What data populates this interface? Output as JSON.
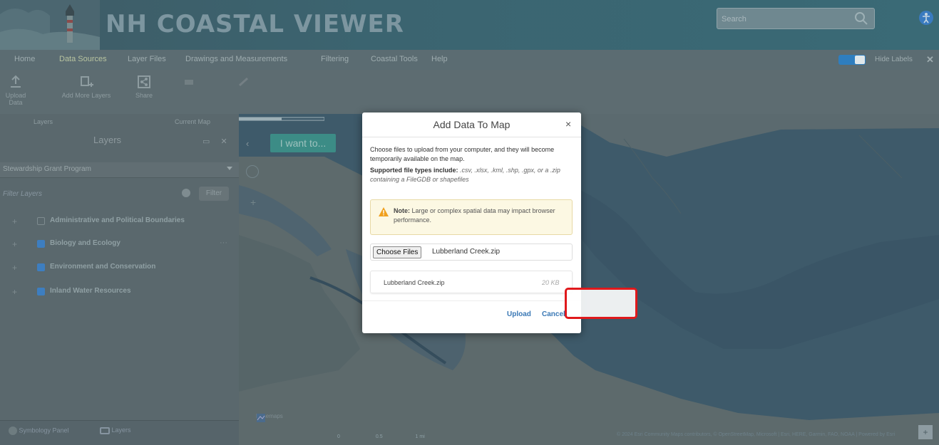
{
  "header": {
    "title": "NH COASTAL VIEWER",
    "search_placeholder": "Search",
    "accent_color": "#3b6470"
  },
  "menubar": {
    "items": [
      "Home",
      "Data Sources",
      "Layer Files",
      "Drawings and Measurements",
      "Filtering",
      "Coastal Tools",
      "Help"
    ],
    "toggle_label": "Hide Labels",
    "close_symbol": "✕"
  },
  "toolbar": {
    "tools": [
      "Upload Data",
      "Add More Layers",
      "Share",
      "",
      ""
    ],
    "group_labels": [
      "Layers",
      "Current Map"
    ]
  },
  "layers_panel": {
    "title": "Layers",
    "selected_layer_list": "Stewardship Grant Program",
    "filter_placeholder": "Filter Layers",
    "filter_button": "Filter",
    "layers": [
      {
        "name": "Administrative and Political Boundaries",
        "checked": false,
        "expand": "+"
      },
      {
        "name": "Biology and Ecology",
        "checked": true,
        "expand": "+"
      },
      {
        "name": "Environment and Conservation",
        "checked": true,
        "expand": "+"
      },
      {
        "name": "Inland Water Resources",
        "checked": true,
        "expand": "+"
      }
    ],
    "bottom_tabs": [
      "Symbology Panel",
      "Layers"
    ]
  },
  "map": {
    "i_want_to_label": "I want to...",
    "basemap_label": "Basemaps",
    "scale_labels": [
      "0",
      "0.5",
      "1 mi"
    ],
    "attribution": "© 2024 Esri Community Maps contributors, © OpenStreetMap, Microsoft | Esri, HERE, Garmin, FAO, NOAA | Powered by Esri",
    "attribution_toggle": "+"
  },
  "modal": {
    "title": "Add Data To Map",
    "close_symbol": "×",
    "description": "Choose files to upload from your computer, and they will become temporarily available on the map.",
    "types_label": "Supported file types include:",
    "types_list": ".csv, .xlsx, .kml, .shp, .gpx, or a .zip containing a FileGDB or shapefiles",
    "note_label": "Note:",
    "note_text": "Large or complex spatial data may impact browser performance.",
    "choose_files_label": "Choose Files",
    "chosen_file": "Lubberland Creek.zip",
    "file_item_name": "Lubberland Creek.zip",
    "file_item_size": "20 KB",
    "upload_label": "Upload",
    "cancel_label": "Cancel"
  },
  "colors": {
    "highlight": "#e0191c",
    "link_blue": "#3a78b5",
    "note_background": "#fcf8e3"
  }
}
